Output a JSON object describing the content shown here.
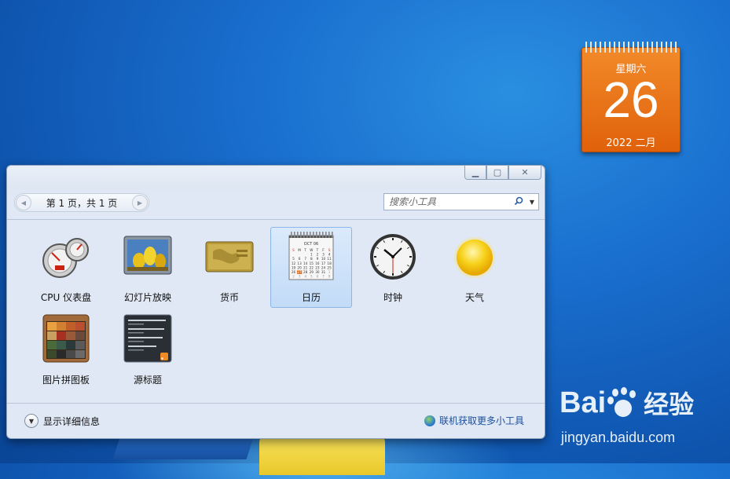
{
  "calendar_gadget": {
    "weekday": "星期六",
    "day": "26",
    "month_year": "2022 二月"
  },
  "window": {
    "pager": {
      "text": "第 1 页，共 1 页"
    },
    "search": {
      "placeholder": "搜索小工具"
    },
    "gadgets": [
      {
        "label": "CPU 仪表盘",
        "icon": "cpu-meter-icon"
      },
      {
        "label": "幻灯片放映",
        "icon": "slideshow-icon"
      },
      {
        "label": "货币",
        "icon": "currency-icon"
      },
      {
        "label": "日历",
        "icon": "calendar-icon",
        "selected": true
      },
      {
        "label": "时钟",
        "icon": "clock-icon"
      },
      {
        "label": "天气",
        "icon": "weather-icon"
      },
      {
        "label": "图片拼图板",
        "icon": "picture-puzzle-icon"
      },
      {
        "label": "源标题",
        "icon": "feed-headlines-icon"
      }
    ],
    "details_toggle": "显示详细信息",
    "online_link": "联机获取更多小工具",
    "mini_calendar": {
      "month": "OCT 06",
      "days": [
        "S",
        "M",
        "T",
        "W",
        "T",
        "F",
        "S"
      ],
      "rows": [
        [
          "",
          "",
          "",
          "1",
          "2",
          "3",
          "4"
        ],
        [
          "5",
          "6",
          "7",
          "8",
          "9",
          "10",
          "11"
        ],
        [
          "12",
          "13",
          "14",
          "15",
          "16",
          "17",
          "18"
        ],
        [
          "19",
          "20",
          "21",
          "22",
          "23",
          "24",
          "25"
        ],
        [
          "26",
          "27",
          "28",
          "29",
          "30",
          "31",
          "1"
        ],
        [
          "2",
          "3",
          "4",
          "5",
          "6",
          "7",
          "8"
        ]
      ]
    }
  },
  "watermark": {
    "brand": "Bai",
    "brand2": "du",
    "suffix": "经验",
    "url": "jingyan.baidu.com"
  },
  "colors": {
    "desktop": "#1a6fcf",
    "calendar": "#e0610a",
    "window": "#dfe8f4",
    "selection": "#c2dbf7",
    "link": "#1c4f9c"
  }
}
